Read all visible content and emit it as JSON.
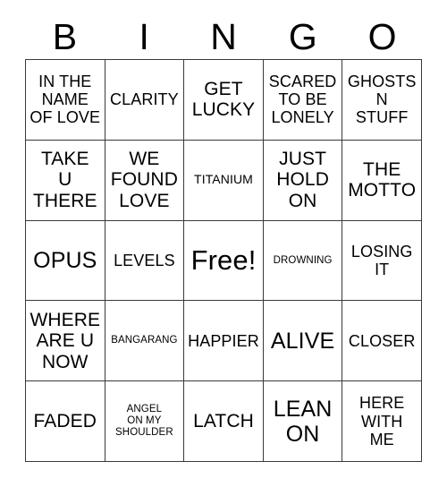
{
  "card": {
    "header_letters": [
      "B",
      "I",
      "N",
      "G",
      "O"
    ],
    "columns": [
      "B",
      "I",
      "N",
      "G",
      "O"
    ],
    "free_space": {
      "row": 2,
      "col": 2,
      "label": "Free!"
    },
    "grid": [
      [
        {
          "label": "IN THE\nNAME\nOF LOVE",
          "size": "m"
        },
        {
          "label": "CLARITY",
          "size": "m"
        },
        {
          "label": "GET\nLUCKY",
          "size": "l"
        },
        {
          "label": "SCARED\nTO BE\nLONELY",
          "size": "m"
        },
        {
          "label": "GHOSTS\nN\nSTUFF",
          "size": "m"
        }
      ],
      [
        {
          "label": "TAKE\nU\nTHERE",
          "size": "l"
        },
        {
          "label": "WE\nFOUND\nLOVE",
          "size": "l"
        },
        {
          "label": "TITANIUM",
          "size": "s"
        },
        {
          "label": "JUST\nHOLD\nON",
          "size": "l"
        },
        {
          "label": "THE\nMOTTO",
          "size": "l"
        }
      ],
      [
        {
          "label": "OPUS",
          "size": "xl"
        },
        {
          "label": "LEVELS",
          "size": "m"
        },
        {
          "label": "Free!",
          "size": "xxl"
        },
        {
          "label": "DROWNING",
          "size": "xs"
        },
        {
          "label": "LOSING\nIT",
          "size": "m"
        }
      ],
      [
        {
          "label": "WHERE\nARE U\nNOW",
          "size": "l"
        },
        {
          "label": "BANGARANG",
          "size": "xs"
        },
        {
          "label": "HAPPIER",
          "size": "m"
        },
        {
          "label": "ALIVE",
          "size": "xl"
        },
        {
          "label": "CLOSER",
          "size": "m"
        }
      ],
      [
        {
          "label": "FADED",
          "size": "l"
        },
        {
          "label": "ANGEL\nON MY\nSHOULDER",
          "size": "xs"
        },
        {
          "label": "LATCH",
          "size": "l"
        },
        {
          "label": "LEAN\nON",
          "size": "xl"
        },
        {
          "label": "HERE\nWITH\nME",
          "size": "m"
        }
      ]
    ]
  },
  "colors": {
    "background": "#ffffff",
    "text": "#000000",
    "border": "#3a3a3a"
  }
}
